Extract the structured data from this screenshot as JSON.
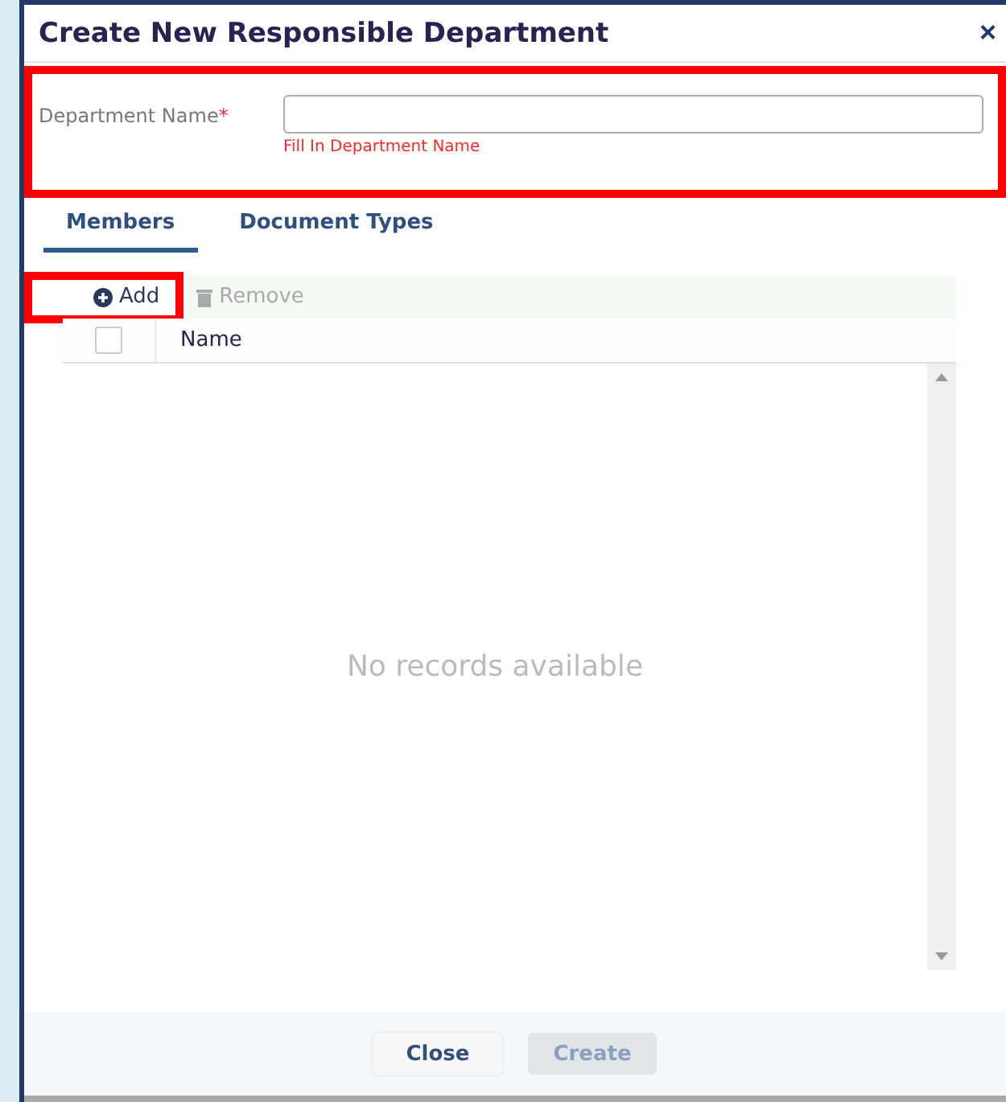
{
  "dialog": {
    "title": "Create New Responsible Department",
    "close_icon": "×"
  },
  "name_field": {
    "label": "Department Name",
    "required_mark": "*",
    "error": "Fill In Department Name",
    "highlighted": true
  },
  "tabs": [
    {
      "label": "Members",
      "selected": true
    },
    {
      "label": "Document Types",
      "selected": false
    }
  ],
  "toolbar": [
    {
      "label": "Add",
      "kind": "add",
      "disabled": false,
      "highlighted": true
    },
    {
      "label": "Remove",
      "kind": "remove",
      "disabled": true,
      "highlighted": false
    }
  ],
  "grid": {
    "columns": [
      "Name"
    ],
    "select_all_checked": false,
    "empty_message": "No records available"
  },
  "buttons": [
    {
      "label": "Close",
      "disabled": false
    },
    {
      "label": "Create",
      "disabled": true
    }
  ]
}
